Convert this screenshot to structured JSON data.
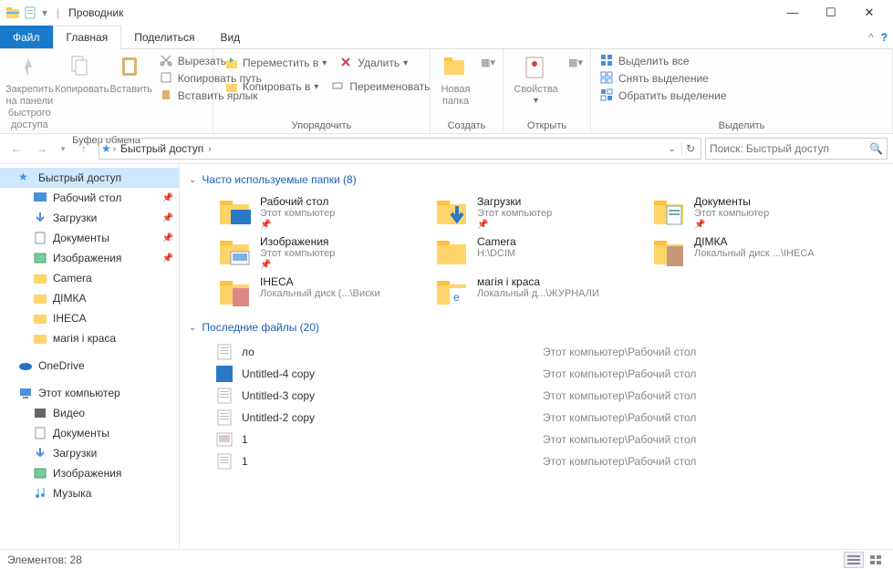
{
  "window": {
    "title": "Проводник"
  },
  "ribbon": {
    "tabs": {
      "file": "Файл",
      "home": "Главная",
      "share": "Поделиться",
      "view": "Вид"
    },
    "groups": {
      "clipboard": {
        "label": "Буфер обмена",
        "pin": "Закрепить на панели\nбыстрого доступа",
        "copy": "Копировать",
        "paste": "Вставить",
        "cut": "Вырезать",
        "copypath": "Копировать путь",
        "pastelink": "Вставить ярлык"
      },
      "organize": {
        "label": "Упорядочить",
        "moveto": "Переместить в",
        "copyto": "Копировать в",
        "del": "Удалить",
        "rename": "Переименовать"
      },
      "new": {
        "label": "Создать",
        "newfolder": "Новая\nпапка"
      },
      "open": {
        "label": "Открыть",
        "props": "Свойства"
      },
      "select": {
        "label": "Выделить",
        "all": "Выделить все",
        "none": "Снять выделение",
        "invert": "Обратить выделение"
      }
    }
  },
  "breadcrumb": {
    "root": "Быстрый доступ"
  },
  "search": {
    "placeholder": "Поиск: Быстрый доступ"
  },
  "nav": {
    "quick": "Быстрый доступ",
    "desktop": "Рабочий стол",
    "downloads": "Загрузки",
    "documents": "Документы",
    "pictures": "Изображения",
    "camera": "Camera",
    "dimka": "ДІМКА",
    "iheca": "IHECA",
    "magia": "магія і краса",
    "onedrive": "OneDrive",
    "thispc": "Этот компьютер",
    "video": "Видео",
    "docs2": "Документы",
    "dl2": "Загрузки",
    "pics2": "Изображения",
    "music": "Музыка"
  },
  "sections": {
    "freq": "Часто используемые папки (8)",
    "recent": "Последние файлы (20)"
  },
  "folders": [
    {
      "name": "Рабочий стол",
      "loc": "Этот компьютер",
      "pinned": true,
      "type": "desktop"
    },
    {
      "name": "Загрузки",
      "loc": "Этот компьютер",
      "pinned": true,
      "type": "downloads"
    },
    {
      "name": "Документы",
      "loc": "Этот компьютер",
      "pinned": true,
      "type": "documents"
    },
    {
      "name": "Изображения",
      "loc": "Этот компьютер",
      "pinned": true,
      "type": "pictures"
    },
    {
      "name": "Camera",
      "loc": "H:\\DCIM",
      "pinned": false,
      "type": "folder"
    },
    {
      "name": "ДІМКА",
      "loc": "Локальный диск ...\\IHECA",
      "pinned": false,
      "type": "thumb"
    },
    {
      "name": "IHECA",
      "loc": "Локальный диск (...\\Виски",
      "pinned": false,
      "type": "thumb2"
    },
    {
      "name": "магія і краса",
      "loc": "Локальный д...\\ЖУРНАЛИ",
      "pinned": false,
      "type": "edge"
    }
  ],
  "files": [
    {
      "name": "ло",
      "path": "Этот компьютер\\Рабочий стол",
      "type": "txt"
    },
    {
      "name": "Untitled-4 copy",
      "path": "Этот компьютер\\Рабочий стол",
      "type": "blue"
    },
    {
      "name": "Untitled-3 copy",
      "path": "Этот компьютер\\Рабочий стол",
      "type": "doc"
    },
    {
      "name": "Untitled-2 copy",
      "path": "Этот компьютер\\Рабочий стол",
      "type": "doc"
    },
    {
      "name": "1",
      "path": "Этот компьютер\\Рабочий стол",
      "type": "img"
    },
    {
      "name": "1",
      "path": "Этот компьютер\\Рабочий стол",
      "type": "doc"
    }
  ],
  "status": {
    "count": "Элементов: 28"
  }
}
